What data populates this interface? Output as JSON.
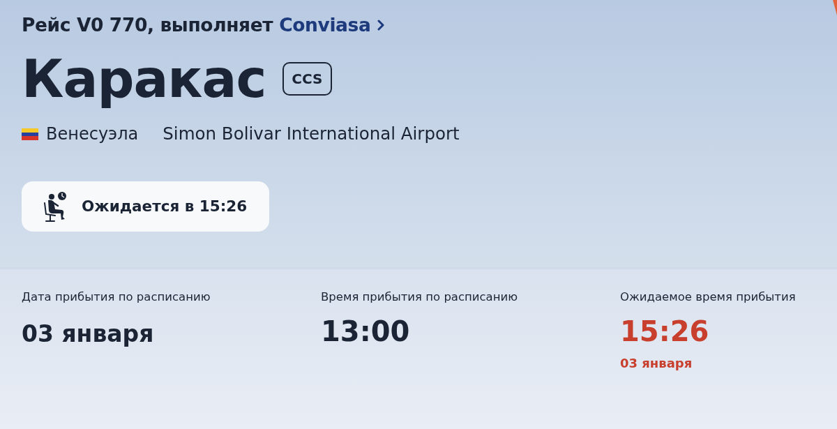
{
  "flight": {
    "prefix": "Рейс V0 770, выполняет",
    "airline": "Conviasa"
  },
  "destination": {
    "city": "Каракас",
    "code": "CCS",
    "country": "Венесуэла",
    "airport": "Simon Bolivar International Airport"
  },
  "status": {
    "text": "Ожидается в 15:26"
  },
  "details": [
    {
      "kind": "date",
      "label": "Дата прибытия по расписанию",
      "value": "03 января",
      "highlight": false
    },
    {
      "kind": "time",
      "label": "Время прибытия по расписанию",
      "value": "13:00",
      "highlight": false
    },
    {
      "kind": "time",
      "label": "Ожидаемое время прибытия",
      "value": "15:26",
      "note": "03 января",
      "highlight": true
    }
  ]
}
